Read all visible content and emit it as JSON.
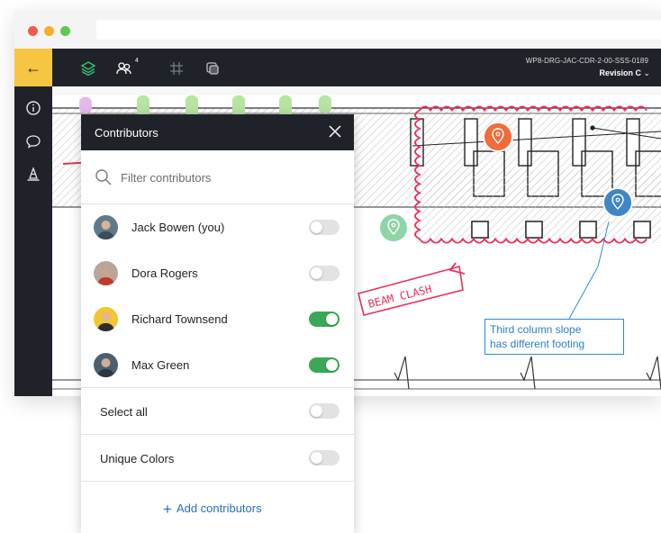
{
  "header": {
    "drawing_id": "WP8-DRG-JAC-CDR-2-00-SSS-0189",
    "revision": "Revision C",
    "comments_badge": "4"
  },
  "icons": {
    "back": "arrow-left-icon",
    "info": "info-icon",
    "comment": "speech-bubble-icon",
    "cone": "traffic-cone-icon",
    "layers": "layers-icon",
    "contributors": "people-icon",
    "grid": "grid-icon",
    "overlay": "overlay-icon"
  },
  "colors": {
    "accent": "#f6c643",
    "toolbar": "#1f2329",
    "toggle_on": "#3aa856",
    "markup_red": "#e8315a",
    "callout_blue": "#2a8bd6"
  },
  "drawing": {
    "annotation_text": "BEAM CLASH",
    "callout_line1": "Third column slope",
    "callout_line2": "has different footing"
  },
  "panel": {
    "title": "Contributors",
    "filter_placeholder": "Filter contributors",
    "contributors": [
      {
        "name": "Jack Bowen (you)",
        "enabled": false
      },
      {
        "name": "Dora Rogers",
        "enabled": false
      },
      {
        "name": "Richard Townsend",
        "enabled": true
      },
      {
        "name": "Max Green",
        "enabled": true
      }
    ],
    "select_all_label": "Select all",
    "select_all_enabled": false,
    "unique_colors_label": "Unique Colors",
    "unique_colors_enabled": false,
    "add_label": "Add contributors"
  }
}
